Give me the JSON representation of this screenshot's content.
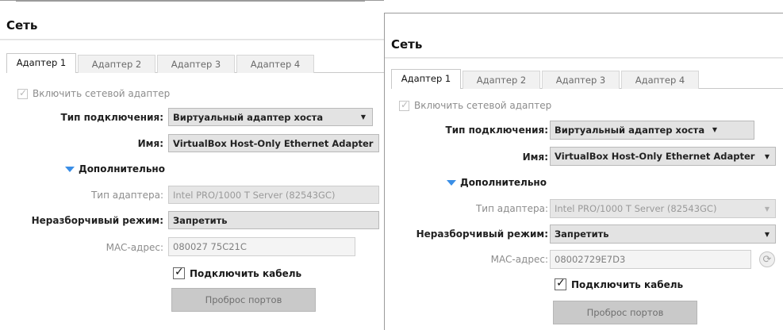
{
  "left": {
    "title": "Сеть",
    "tabs": [
      "Адаптер 1",
      "Адаптер 2",
      "Адаптер 3",
      "Адаптер 4"
    ],
    "enable_adapter": "Включить сетевой адаптер",
    "connection_type_label": "Тип подключения:",
    "connection_type_value": "Виртуальный адаптер хоста",
    "name_label": "Имя:",
    "name_value": "VirtualBox Host-Only Ethernet Adapter",
    "advanced": "Дополнительно",
    "adapter_type_label": "Тип адаптера:",
    "adapter_type_value": "Intel PRO/1000 T Server (82543GC)",
    "promisc_label": "Неразборчивый режим:",
    "promisc_value": "Запретить",
    "mac_label": "MAC-адрес:",
    "mac_value": "080027 75C21C",
    "cable_label": "Подключить кабель",
    "port_forwarding": "Проброс портов"
  },
  "right": {
    "title": "Сеть",
    "tabs": [
      "Адаптер 1",
      "Адаптер 2",
      "Адаптер 3",
      "Адаптер 4"
    ],
    "enable_adapter": "Включить сетевой адаптер",
    "connection_type_label": "Тип подключения:",
    "connection_type_value": "Виртуальный адаптер хоста",
    "name_label": "Имя:",
    "name_value": "VirtualBox Host-Only Ethernet Adapter",
    "advanced": "Дополнительно",
    "adapter_type_label": "Тип адаптера:",
    "adapter_type_value": "Intel PRO/1000 T Server (82543GC)",
    "promisc_label": "Неразборчивый режим:",
    "promisc_value": "Запретить",
    "mac_label": "MAC-адрес:",
    "mac_value": "08002729E7D3",
    "cable_label": "Подключить кабель",
    "port_forwarding": "Проброс портов"
  },
  "icons": {
    "check": "check-icon",
    "dropdown": "chevron-down-icon",
    "disclosure": "triangle-down-icon",
    "refresh": "refresh-icon"
  },
  "colors": {
    "disclosure_triangle": "#3a8ee6",
    "disabled_field": "#e6e6e6",
    "button_disabled": "#c9c9c9"
  }
}
